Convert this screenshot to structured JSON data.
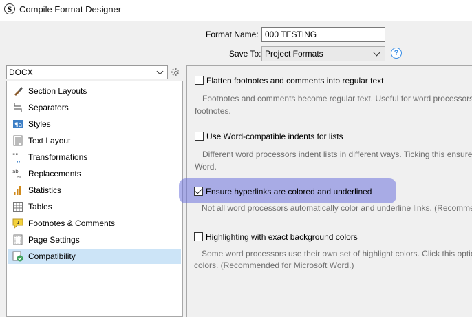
{
  "window": {
    "title": "Compile Format Designer"
  },
  "form": {
    "format_name_label": "Format Name:",
    "format_name_value": "000 TESTING",
    "save_to_label": "Save To:",
    "save_to_value": "Project Formats"
  },
  "sidebar": {
    "format_select": "DOCX",
    "items": [
      {
        "label": "Section Layouts",
        "icon": "brush-icon"
      },
      {
        "label": "Separators",
        "icon": "separator-icon"
      },
      {
        "label": "Styles",
        "icon": "styles-icon"
      },
      {
        "label": "Text Layout",
        "icon": "text-layout-icon"
      },
      {
        "label": "Transformations",
        "icon": "transformations-icon"
      },
      {
        "label": "Replacements",
        "icon": "replacements-icon"
      },
      {
        "label": "Statistics",
        "icon": "statistics-icon"
      },
      {
        "label": "Tables",
        "icon": "table-icon"
      },
      {
        "label": "Footnotes & Comments",
        "icon": "footnote-icon"
      },
      {
        "label": "Page Settings",
        "icon": "page-settings-icon"
      },
      {
        "label": "Compatibility",
        "icon": "compatibility-icon",
        "selected": true
      }
    ]
  },
  "options": [
    {
      "label": "Flatten footnotes and comments into regular text",
      "checked": false,
      "desc_line1": "Footnotes and comments become regular text. Useful for word processors",
      "desc_line2": "footnotes."
    },
    {
      "label": "Use Word-compatible indents for lists",
      "checked": false,
      "desc_line1": "Different word processors indent lists in different ways. Ticking this ensures",
      "desc_line2": "Word."
    },
    {
      "label": "Ensure hyperlinks are colored and underlined",
      "checked": true,
      "desc_line1": "Not all word processors automatically color and underline links. (Recomme",
      "desc_line2": ""
    },
    {
      "label": "Highlighting with exact background colors",
      "checked": false,
      "desc_line1": "Some word processors use their own set of highlight colors. Click this optio",
      "desc_line2": "colors. (Recommended for Microsoft Word.)"
    }
  ],
  "colors": {
    "selection": "#cce4f7",
    "highlight_band": "#6e73dc",
    "help_blue": "#3a8ee6"
  }
}
